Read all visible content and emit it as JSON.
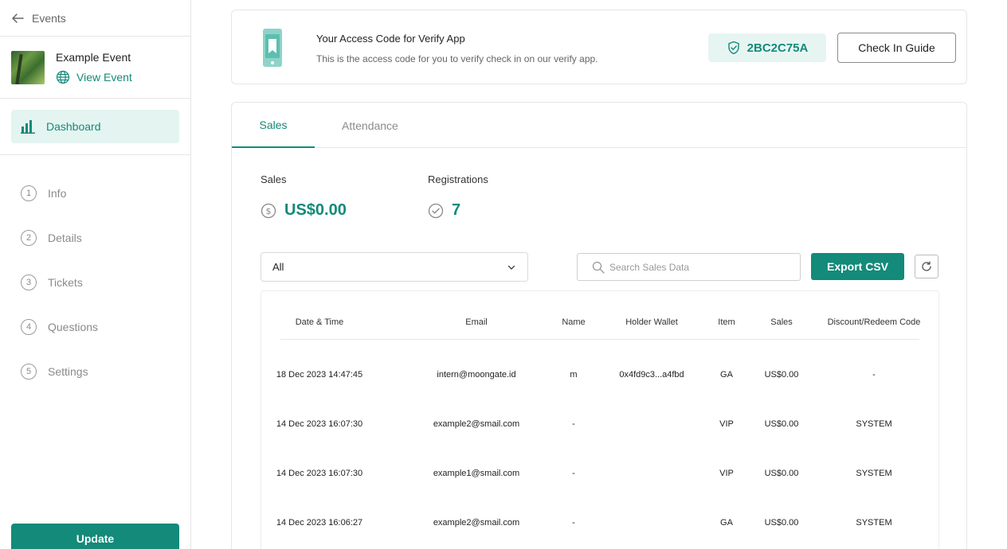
{
  "sidebar": {
    "back_label": "Events",
    "event_name": "Example Event",
    "view_event_label": "View Event",
    "dashboard_label": "Dashboard",
    "steps": [
      {
        "num": "1",
        "label": "Info"
      },
      {
        "num": "2",
        "label": "Details"
      },
      {
        "num": "3",
        "label": "Tickets"
      },
      {
        "num": "4",
        "label": "Questions"
      },
      {
        "num": "5",
        "label": "Settings"
      }
    ],
    "update_label": "Update"
  },
  "access": {
    "title": "Your Access Code for Verify App",
    "subtitle": "This is the access code for you to verify check in on our verify app.",
    "code": "2BC2C75A",
    "guide_label": "Check In Guide"
  },
  "tabs": {
    "sales": "Sales",
    "attendance": "Attendance"
  },
  "stats": {
    "sales_label": "Sales",
    "sales_value": "US$0.00",
    "registrations_label": "Registrations",
    "registrations_value": "7"
  },
  "controls": {
    "filter_value": "All",
    "search_placeholder": "Search Sales Data",
    "export_label": "Export CSV"
  },
  "table": {
    "headers": {
      "datetime": "Date & Time",
      "email": "Email",
      "name": "Name",
      "wallet": "Holder Wallet",
      "item": "Item",
      "sales": "Sales",
      "code": "Discount/Redeem Code"
    },
    "rows": [
      {
        "datetime": "18 Dec 2023 14:47:45",
        "email": "intern@moongate.id",
        "name": "m",
        "wallet": "0x4fd9c3...a4fbd",
        "item": "GA",
        "sales": "US$0.00",
        "code": "-"
      },
      {
        "datetime": "14 Dec 2023 16:07:30",
        "email": "example2@smail.com",
        "name": "-",
        "wallet": "",
        "item": "VIP",
        "sales": "US$0.00",
        "code": "SYSTEM"
      },
      {
        "datetime": "14 Dec 2023 16:07:30",
        "email": "example1@smail.com",
        "name": "-",
        "wallet": "",
        "item": "VIP",
        "sales": "US$0.00",
        "code": "SYSTEM"
      },
      {
        "datetime": "14 Dec 2023 16:06:27",
        "email": "example2@smail.com",
        "name": "-",
        "wallet": "",
        "item": "GA",
        "sales": "US$0.00",
        "code": "SYSTEM"
      }
    ]
  },
  "colors": {
    "accent": "#138a7a",
    "accent_light": "#e4f4f1"
  }
}
